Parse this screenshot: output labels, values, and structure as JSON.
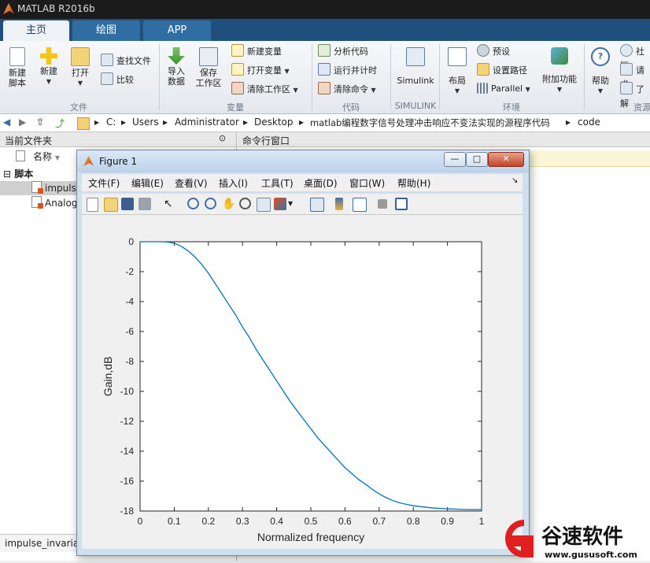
{
  "app": {
    "title": "MATLAB R2016b"
  },
  "tabs": [
    {
      "label": "主页",
      "active": true
    },
    {
      "label": "绘图",
      "active": false
    },
    {
      "label": "APP",
      "active": false
    }
  ],
  "ribbon": {
    "file_group": {
      "name": "文件",
      "new_script": "新建\n脚本",
      "new": "新建",
      "open": "打开",
      "find_files": "查找文件",
      "compare": "比较"
    },
    "variable_group": {
      "name": "变量",
      "import_data": "导入\n数据",
      "save_workspace": "保存\n工作区",
      "new_variable": "新建变量",
      "open_variable": "打开变量",
      "clear_workspace": "清除工作区"
    },
    "code_group": {
      "name": "代码",
      "analyze_code": "分析代码",
      "run_and_time": "运行并计时",
      "clear_commands": "清除命令"
    },
    "simulink_group": {
      "name": "SIMULINK",
      "simulink": "Simulink"
    },
    "environment_group": {
      "name": "环境",
      "layout": "布局",
      "preferences": "预设",
      "set_path": "设置路径",
      "parallel": "Parallel",
      "addons": "附加功能"
    },
    "resources_group": {
      "name": "资源",
      "help": "帮助",
      "community": "社区",
      "request_support": "请求",
      "learn": "了解"
    }
  },
  "address": {
    "segments": [
      "C:",
      "Users",
      "Administrator",
      "Desktop",
      "matlab编程数字信号处理冲击响应不变法实现的源程序代码",
      "code"
    ]
  },
  "current_folder": {
    "title": "当前文件夹",
    "column_name": "名称",
    "section": "脚本",
    "files": [
      "impuls",
      "Analog"
    ],
    "details_file": "impulse_invariar"
  },
  "command_window": {
    "title": "命令行窗口"
  },
  "figure": {
    "title": "Figure 1",
    "menu": [
      "文件(F)",
      "编辑(E)",
      "查看(V)",
      "插入(I)",
      "工具(T)",
      "桌面(D)",
      "窗口(W)",
      "帮助(H)"
    ],
    "window_buttons": {
      "minimize": "—",
      "maximize": "□",
      "close": "✕"
    }
  },
  "chart_data": {
    "type": "line",
    "title": "",
    "xlabel": "Normalized frequency",
    "ylabel": "Gain,dB",
    "xlim": [
      0,
      1
    ],
    "ylim": [
      -18,
      0
    ],
    "xticks": [
      0,
      0.1,
      0.2,
      0.3,
      0.4,
      0.5,
      0.6,
      0.7,
      0.8,
      0.9,
      1
    ],
    "xtick_labels": [
      "0",
      "0.1",
      "0.2",
      "0.3",
      "0.4",
      "0.5",
      "0.6",
      "0.7",
      "0.8",
      "0.9",
      "1"
    ],
    "yticks": [
      0,
      -2,
      -4,
      -6,
      -8,
      -10,
      -12,
      -14,
      -16,
      -18
    ],
    "ytick_labels": [
      "0",
      "-2",
      "-4",
      "-6",
      "-8",
      "-10",
      "-12",
      "-14",
      "-16",
      "-18"
    ],
    "grid": false,
    "line_color": "#0072bd",
    "series": [
      {
        "x": [
          0,
          0.02,
          0.04,
          0.06,
          0.08,
          0.1,
          0.12,
          0.14,
          0.16,
          0.18,
          0.2,
          0.22,
          0.24,
          0.26,
          0.28,
          0.3,
          0.32,
          0.34,
          0.36,
          0.38,
          0.4,
          0.42,
          0.44,
          0.46,
          0.48,
          0.5,
          0.52,
          0.54,
          0.56,
          0.58,
          0.6,
          0.62,
          0.64,
          0.66,
          0.68,
          0.7,
          0.72,
          0.74,
          0.76,
          0.78,
          0.8,
          0.82,
          0.84,
          0.86,
          0.88,
          0.9,
          0.92,
          0.94,
          0.96,
          0.98,
          1
        ],
        "y": [
          0,
          0,
          0,
          0,
          -0.02,
          -0.1,
          -0.3,
          -0.6,
          -1.0,
          -1.5,
          -2.1,
          -2.8,
          -3.5,
          -4.2,
          -4.9,
          -5.7,
          -6.4,
          -7.2,
          -7.9,
          -8.6,
          -9.3,
          -10.0,
          -10.7,
          -11.3,
          -11.9,
          -12.5,
          -13.1,
          -13.6,
          -14.1,
          -14.6,
          -15.1,
          -15.5,
          -15.9,
          -16.2,
          -16.55,
          -16.85,
          -17.1,
          -17.3,
          -17.45,
          -17.55,
          -17.65,
          -17.7,
          -17.75,
          -17.8,
          -17.82,
          -17.85,
          -17.87,
          -17.89,
          -17.9,
          -17.9,
          -17.9
        ]
      }
    ]
  },
  "watermark": {
    "brand": "谷速软件",
    "url": "www.gususoft.com"
  }
}
